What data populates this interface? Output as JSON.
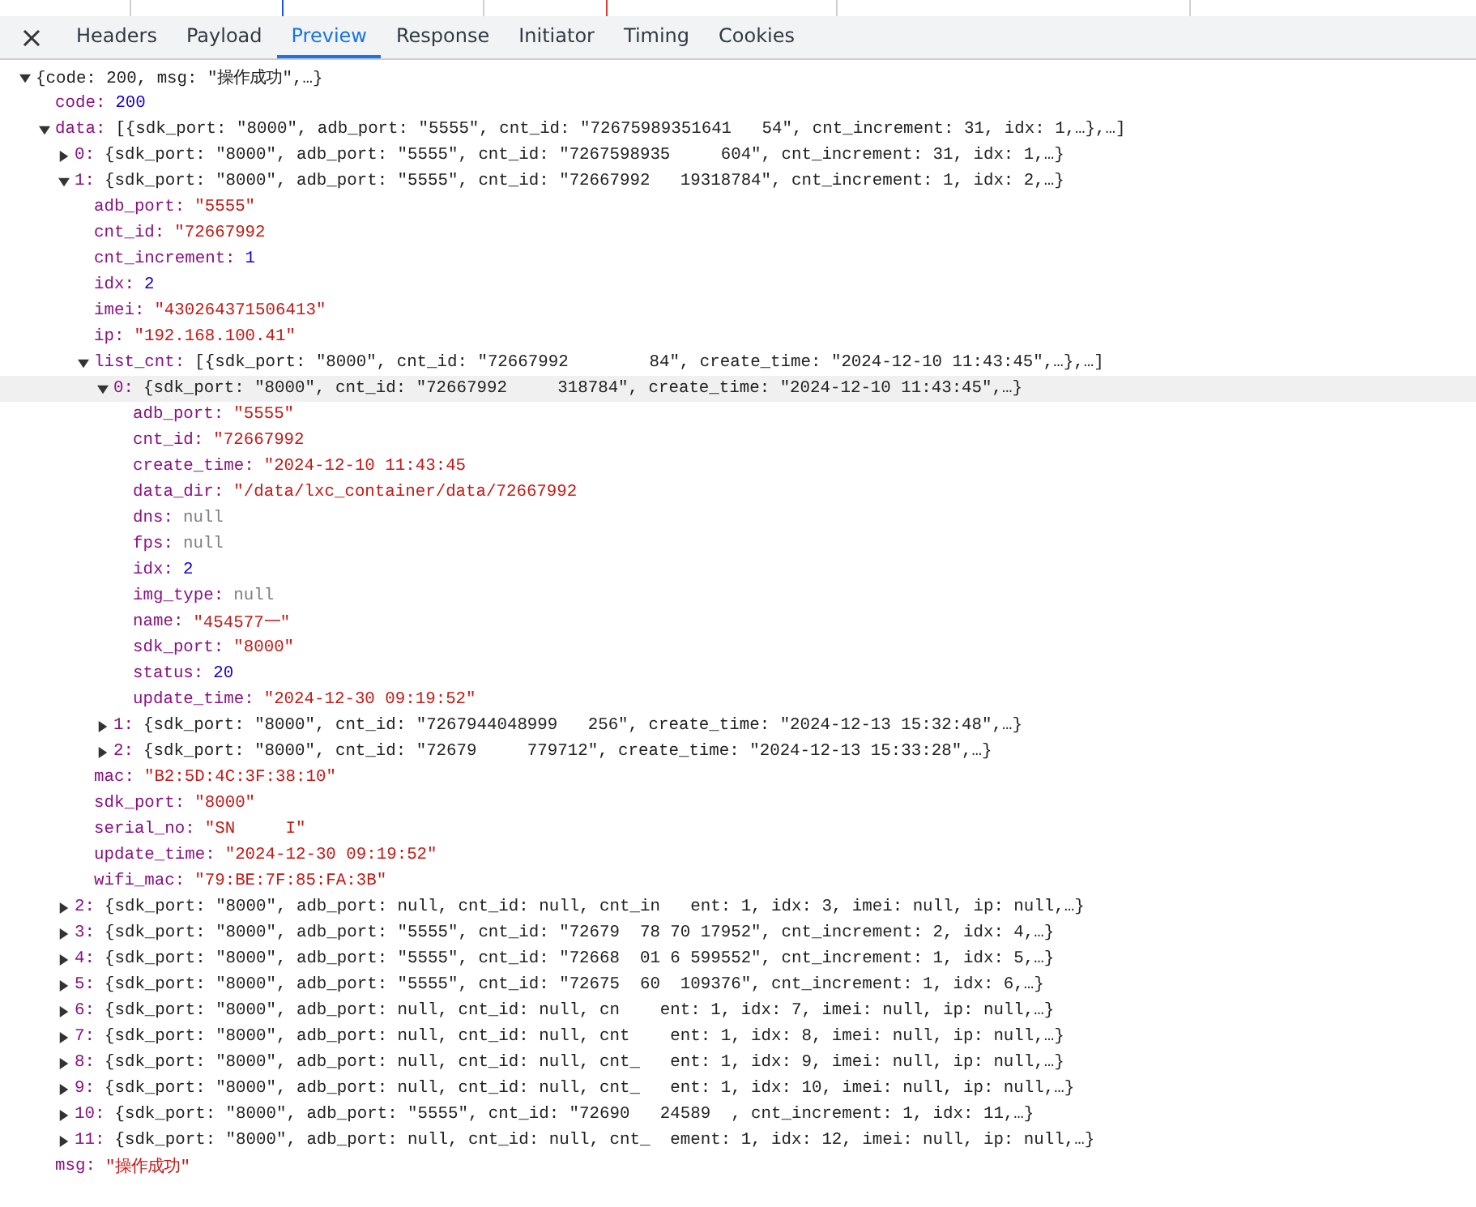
{
  "tabs": [
    {
      "label": "Headers",
      "selected": false
    },
    {
      "label": "Payload",
      "selected": false
    },
    {
      "label": "Preview",
      "selected": true
    },
    {
      "label": "Response",
      "selected": false
    },
    {
      "label": "Initiator",
      "selected": false
    },
    {
      "label": "Timing",
      "selected": false
    },
    {
      "label": "Cookies",
      "selected": false
    }
  ],
  "tree": {
    "kind": "object",
    "expanded": true,
    "selected": false,
    "summary": "{code: 200, msg: \"操作成功\",…}",
    "children": [
      {
        "key": "code:",
        "kind": "number",
        "value": "200",
        "selected": false
      },
      {
        "key": "data:",
        "kind": "object",
        "expanded": true,
        "selected": false,
        "summary": "[{sdk_port: \"8000\", adb_port: \"5555\", cnt_id: \"72675989351641   54\", cnt_increment: 31, idx: 1,…},…]",
        "children": [
          {
            "key": "0:",
            "kind": "object",
            "expanded": false,
            "selected": false,
            "summary": "{sdk_port: \"8000\", adb_port: \"5555\", cnt_id: \"7267598935     604\", cnt_increment: 31, idx: 1,…}"
          },
          {
            "key": "1:",
            "kind": "object",
            "expanded": true,
            "selected": false,
            "summary": "{sdk_port: \"8000\", adb_port: \"5555\", cnt_id: \"72667992   19318784\", cnt_increment: 1, idx: 2,…}",
            "children": [
              {
                "key": "adb_port:",
                "kind": "string",
                "value": "\"5555\"",
                "selected": false
              },
              {
                "key": "cnt_id:",
                "kind": "string",
                "value": "\"72667992",
                "selected": false
              },
              {
                "key": "cnt_increment:",
                "kind": "number",
                "value": "1",
                "selected": false
              },
              {
                "key": "idx:",
                "kind": "number",
                "value": "2",
                "selected": false
              },
              {
                "key": "imei:",
                "kind": "string",
                "value": "\"430264371506413\"",
                "selected": false
              },
              {
                "key": "ip:",
                "kind": "string",
                "value": "\"192.168.100.41\"",
                "selected": false
              },
              {
                "key": "list_cnt:",
                "kind": "object",
                "expanded": true,
                "selected": false,
                "summary": "[{sdk_port: \"8000\", cnt_id: \"72667992        84\", create_time: \"2024-12-10 11:43:45\",…},…]",
                "children": [
                  {
                    "key": "0:",
                    "kind": "object",
                    "expanded": true,
                    "selected": true,
                    "summary": "{sdk_port: \"8000\", cnt_id: \"72667992     318784\", create_time: \"2024-12-10 11:43:45\",…}",
                    "children": [
                      {
                        "key": "adb_port:",
                        "kind": "string",
                        "value": "\"5555\"",
                        "selected": false
                      },
                      {
                        "key": "cnt_id:",
                        "kind": "string",
                        "value": "\"72667992",
                        "selected": false
                      },
                      {
                        "key": "create_time:",
                        "kind": "string",
                        "value": "\"2024-12-10 11:43:45",
                        "selected": false
                      },
                      {
                        "key": "data_dir:",
                        "kind": "string",
                        "value": "\"/data/lxc_container/data/72667992",
                        "selected": false
                      },
                      {
                        "key": "dns:",
                        "kind": "null",
                        "value": "null",
                        "selected": false
                      },
                      {
                        "key": "fps:",
                        "kind": "null",
                        "value": "null",
                        "selected": false
                      },
                      {
                        "key": "idx:",
                        "kind": "number",
                        "value": "2",
                        "selected": false
                      },
                      {
                        "key": "img_type:",
                        "kind": "null",
                        "value": "null",
                        "selected": false
                      },
                      {
                        "key": "name:",
                        "kind": "string",
                        "value": "\"454577一\"",
                        "selected": false
                      },
                      {
                        "key": "sdk_port:",
                        "kind": "string",
                        "value": "\"8000\"",
                        "selected": false
                      },
                      {
                        "key": "status:",
                        "kind": "number",
                        "value": "20",
                        "selected": false
                      },
                      {
                        "key": "update_time:",
                        "kind": "string",
                        "value": "\"2024-12-30 09:19:52\"",
                        "selected": false
                      }
                    ]
                  },
                  {
                    "key": "1:",
                    "kind": "object",
                    "expanded": false,
                    "selected": false,
                    "summary": "{sdk_port: \"8000\", cnt_id: \"7267944048999   256\", create_time: \"2024-12-13 15:32:48\",…}"
                  },
                  {
                    "key": "2:",
                    "kind": "object",
                    "expanded": false,
                    "selected": false,
                    "summary": "{sdk_port: \"8000\", cnt_id: \"72679     779712\", create_time: \"2024-12-13 15:33:28\",…}"
                  }
                ]
              },
              {
                "key": "mac:",
                "kind": "string",
                "value": "\"B2:5D:4C:3F:38:10\"",
                "selected": false
              },
              {
                "key": "sdk_port:",
                "kind": "string",
                "value": "\"8000\"",
                "selected": false
              },
              {
                "key": "serial_no:",
                "kind": "string",
                "value": "\"SN     I\"",
                "selected": false
              },
              {
                "key": "update_time:",
                "kind": "string",
                "value": "\"2024-12-30 09:19:52\"",
                "selected": false
              },
              {
                "key": "wifi_mac:",
                "kind": "string",
                "value": "\"79:BE:7F:85:FA:3B\"",
                "selected": false
              }
            ]
          },
          {
            "key": "2:",
            "kind": "object",
            "expanded": false,
            "selected": false,
            "summary": "{sdk_port: \"8000\", adb_port: null, cnt_id: null, cnt_in   ent: 1, idx: 3, imei: null, ip: null,…}"
          },
          {
            "key": "3:",
            "kind": "object",
            "expanded": false,
            "selected": false,
            "summary": "{sdk_port: \"8000\", adb_port: \"5555\", cnt_id: \"72679  78 70 17952\", cnt_increment: 2, idx: 4,…}"
          },
          {
            "key": "4:",
            "kind": "object",
            "expanded": false,
            "selected": false,
            "summary": "{sdk_port: \"8000\", adb_port: \"5555\", cnt_id: \"72668  01 6 599552\", cnt_increment: 1, idx: 5,…}"
          },
          {
            "key": "5:",
            "kind": "object",
            "expanded": false,
            "selected": false,
            "summary": "{sdk_port: \"8000\", adb_port: \"5555\", cnt_id: \"72675  60  109376\", cnt_increment: 1, idx: 6,…}"
          },
          {
            "key": "6:",
            "kind": "object",
            "expanded": false,
            "selected": false,
            "summary": "{sdk_port: \"8000\", adb_port: null, cnt_id: null, cn    ent: 1, idx: 7, imei: null, ip: null,…}"
          },
          {
            "key": "7:",
            "kind": "object",
            "expanded": false,
            "selected": false,
            "summary": "{sdk_port: \"8000\", adb_port: null, cnt_id: null, cnt    ent: 1, idx: 8, imei: null, ip: null,…}"
          },
          {
            "key": "8:",
            "kind": "object",
            "expanded": false,
            "selected": false,
            "summary": "{sdk_port: \"8000\", adb_port: null, cnt_id: null, cnt_   ent: 1, idx: 9, imei: null, ip: null,…}"
          },
          {
            "key": "9:",
            "kind": "object",
            "expanded": false,
            "selected": false,
            "summary": "{sdk_port: \"8000\", adb_port: null, cnt_id: null, cnt_   ent: 1, idx: 10, imei: null, ip: null,…}"
          },
          {
            "key": "10:",
            "kind": "object",
            "expanded": false,
            "selected": false,
            "summary": "{sdk_port: \"8000\", adb_port: \"5555\", cnt_id: \"72690   24589  , cnt_increment: 1, idx: 11,…}"
          },
          {
            "key": "11:",
            "kind": "object",
            "expanded": false,
            "selected": false,
            "summary": "{sdk_port: \"8000\", adb_port: null, cnt_id: null, cnt_  ement: 1, idx: 12, imei: null, ip: null,…}"
          }
        ]
      },
      {
        "key": "msg:",
        "kind": "string",
        "value": "\"操作成功\"",
        "selected": false
      }
    ]
  }
}
